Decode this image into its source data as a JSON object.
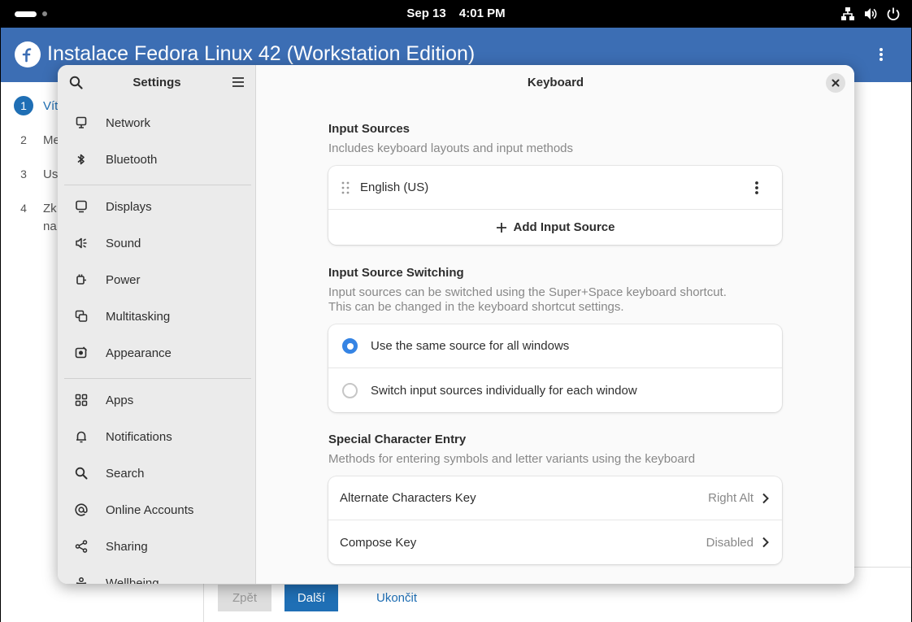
{
  "topbar": {
    "date": "Sep 13",
    "time": "4:01 PM"
  },
  "installer": {
    "title": "Instalace Fedora Linux 42 (Workstation Edition)",
    "steps": [
      {
        "num": "1",
        "label": "Vít"
      },
      {
        "num": "2",
        "label": "Me"
      },
      {
        "num": "3",
        "label": "Us"
      },
      {
        "num": "4",
        "label": "Zk",
        "label2": "na"
      }
    ],
    "back_label": "Zpět",
    "next_label": "Další",
    "quit_label": "Ukončit"
  },
  "settings": {
    "sidebar_title": "Settings",
    "items": [
      {
        "label": "Network",
        "icon": "network-icon"
      },
      {
        "label": "Bluetooth",
        "icon": "bluetooth-icon"
      },
      {
        "label": "Displays",
        "icon": "display-icon"
      },
      {
        "label": "Sound",
        "icon": "speaker-icon"
      },
      {
        "label": "Power",
        "icon": "power-plug-icon"
      },
      {
        "label": "Multitasking",
        "icon": "multitasking-icon"
      },
      {
        "label": "Appearance",
        "icon": "appearance-icon"
      },
      {
        "label": "Apps",
        "icon": "apps-grid-icon"
      },
      {
        "label": "Notifications",
        "icon": "bell-icon"
      },
      {
        "label": "Search",
        "icon": "search-icon"
      },
      {
        "label": "Online Accounts",
        "icon": "at-sign-icon"
      },
      {
        "label": "Sharing",
        "icon": "share-icon"
      },
      {
        "label": "Wellbeing",
        "icon": "wellbeing-icon"
      }
    ],
    "page_title": "Keyboard",
    "input_sources": {
      "title": "Input Sources",
      "desc": "Includes keyboard layouts and input methods",
      "source": "English (US)",
      "add_label": "Add Input Source"
    },
    "switching": {
      "title": "Input Source Switching",
      "desc1": "Input sources can be switched using the Super+Space keyboard shortcut.",
      "desc2": "This can be changed in the keyboard shortcut settings.",
      "option1": "Use the same source for all windows",
      "option2": "Switch input sources individually for each window",
      "selected": "option1"
    },
    "special": {
      "title": "Special Character Entry",
      "desc": "Methods for entering symbols and letter variants using the keyboard",
      "alt_label": "Alternate Characters Key",
      "alt_value": "Right Alt",
      "compose_label": "Compose Key",
      "compose_value": "Disabled"
    }
  },
  "colors": {
    "accent": "#3584e4",
    "installer_header": "#3c6eb4",
    "installer_button": "#1f6fb5"
  }
}
